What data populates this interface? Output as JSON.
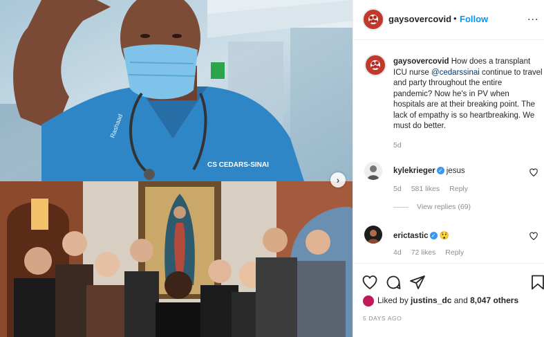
{
  "media": {
    "top_photo": {
      "badge_logo_text": "CS CEDARS-SINAI",
      "name_embroidery": "Rashaad"
    },
    "bottom_photo": {}
  },
  "header": {
    "username": "gaysovercovid",
    "separator": "•",
    "follow_label": "Follow",
    "more_label": "..."
  },
  "caption": {
    "username": "gaysovercovid",
    "text_before_mention": " How does a transplant ICU nurse ",
    "mention": "@cedarssinai",
    "text_after_mention": " continue to travel and party throughout the entire pandemic? Now he's in PV when hospitals are at their breaking point. The lack of empathy is so heartbreaking. We must do better.",
    "time": "5d"
  },
  "comments": [
    {
      "username": "kylekrieger",
      "text": "jesus",
      "time": "5d",
      "likes": "581 likes",
      "reply": "Reply",
      "verified": true
    },
    {
      "username": "erictastic",
      "text": "😲",
      "time": "4d",
      "likes": "72 likes",
      "reply": "Reply",
      "verified": true
    }
  ],
  "view_replies": "View replies (69)",
  "likes": {
    "prefix": "Liked by ",
    "user": "justins_dc",
    "middle": " and ",
    "count": "8,047 others"
  },
  "post_date": "5 DAYS AGO",
  "icons": [
    "heart-icon",
    "comment-icon",
    "share-icon",
    "bookmark-icon",
    "verified-icon",
    "chevron-right-icon"
  ],
  "colors": {
    "follow": "#0095f6",
    "verified": "#3897f0",
    "secondary_text": "#8e8e8e"
  }
}
